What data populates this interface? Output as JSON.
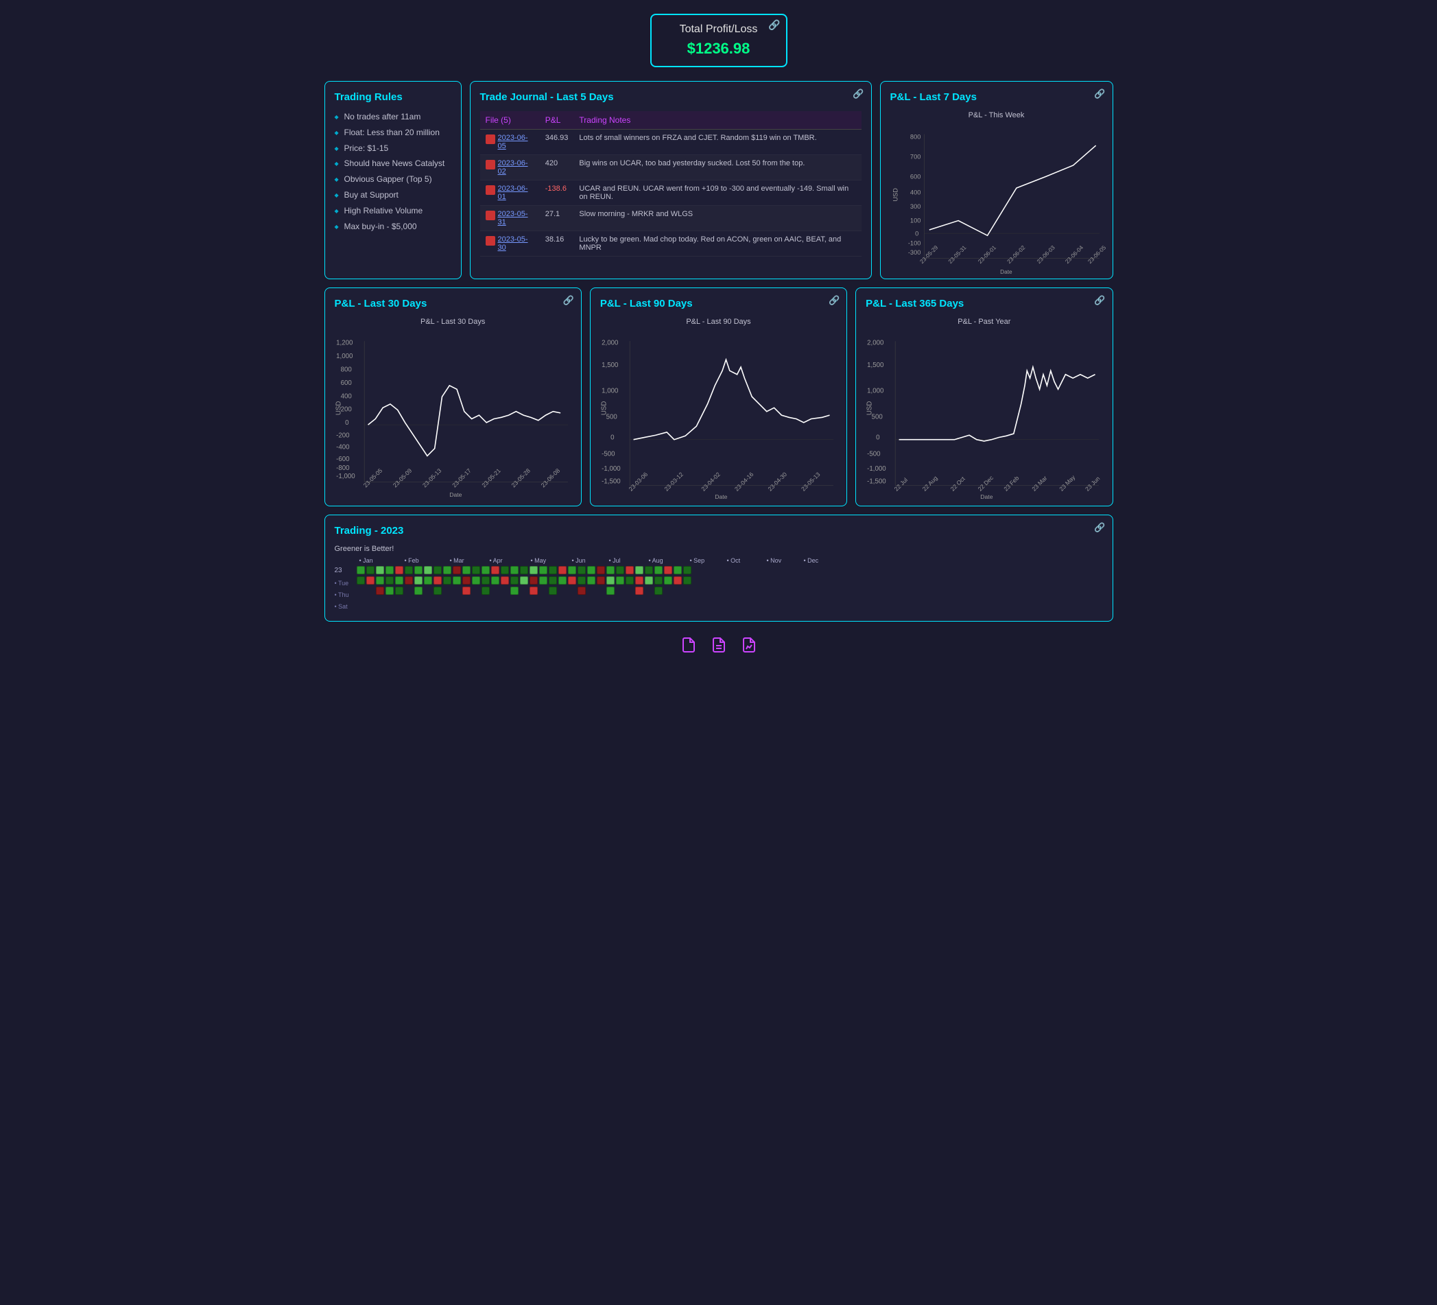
{
  "header": {
    "title": "Total Profit/Loss",
    "value": "$1236.98",
    "link_icon": "🔗"
  },
  "trading_rules": {
    "title": "Trading Rules",
    "rules": [
      "No trades after 11am",
      "Float: Less than 20 million",
      "Price: $1-15",
      "Should have News Catalyst",
      "Obvious Gapper (Top 5)",
      "Buy at Support",
      "High Relative Volume",
      "Max buy-in - $5,000"
    ]
  },
  "trade_journal": {
    "title": "Trade Journal - Last 5 Days",
    "link_icon": "🔗",
    "column_file": "File (5)",
    "column_pnl": "P&L",
    "column_notes": "Trading Notes",
    "rows": [
      {
        "date": "2023-06-05",
        "pnl": "346.93",
        "notes": "Lots of small winners on FRZA and CJET. Random $119 win on TMBR."
      },
      {
        "date": "2023-06-02",
        "pnl": "420",
        "notes": "Big wins on UCAR, too bad yesterday sucked. Lost 50 from the top."
      },
      {
        "date": "2023-06-01",
        "pnl": "-138.6",
        "notes": "UCAR and REUN. UCAR went from +109 to -300 and eventually -149. Small win on REUN."
      },
      {
        "date": "2023-05-31",
        "pnl": "27.1",
        "notes": "Slow morning - MRKR and WLGS"
      },
      {
        "date": "2023-05-30",
        "pnl": "38.16",
        "notes": "Lucky to be green. Mad chop today. Red on ACON, green on AAIC, BEAT, and MNPR"
      }
    ]
  },
  "pnl_7days": {
    "title": "P&L - Last 7 Days",
    "chart_title": "P&L - This Week",
    "link_icon": "🔗",
    "x_label": "Date",
    "y_label": "USD",
    "dates": [
      "23-05-29",
      "23-05-31",
      "23-06-01",
      "23-06-02",
      "23-06-03",
      "23-06-04",
      "23-06-05"
    ],
    "values": [
      -50,
      30,
      -100,
      320,
      420,
      520,
      700
    ],
    "y_min": -300,
    "y_max": 800
  },
  "pnl_30days": {
    "title": "P&L - Last 30 Days",
    "chart_title": "P&L - Last 30 Days",
    "link_icon": "🔗",
    "y_min": -1400,
    "y_max": 1200
  },
  "pnl_90days": {
    "title": "P&L - Last 90 Days",
    "chart_title": "P&L - Last 90 Days",
    "link_icon": "🔗",
    "y_min": -1500,
    "y_max": 2000
  },
  "pnl_365days": {
    "title": "P&L - Last 365 Days",
    "chart_title": "P&L - Past Year",
    "link_icon": "🔗",
    "y_min": -1500,
    "y_max": 2000
  },
  "trading_2023": {
    "title": "Trading - 2023",
    "link_icon": "🔗",
    "subtitle": "Greener is Better!",
    "year_label": "23",
    "months": [
      "Jan",
      "Feb",
      "Mar",
      "Apr",
      "May",
      "Jun",
      "Jul",
      "Aug",
      "Sep",
      "Oct",
      "Nov",
      "Dec"
    ],
    "row_labels": [
      "Tue",
      "Thu",
      "Sat"
    ],
    "dot_colors": {
      "jan": "#aaaacc",
      "feb": "#aaaacc",
      "mar": "#aaaacc",
      "apr": "#aaaacc",
      "may": "#aaaacc",
      "jun": "#aaaacc"
    }
  },
  "footer": {
    "icons": [
      "file-icon",
      "journal-icon",
      "chart-icon"
    ]
  }
}
